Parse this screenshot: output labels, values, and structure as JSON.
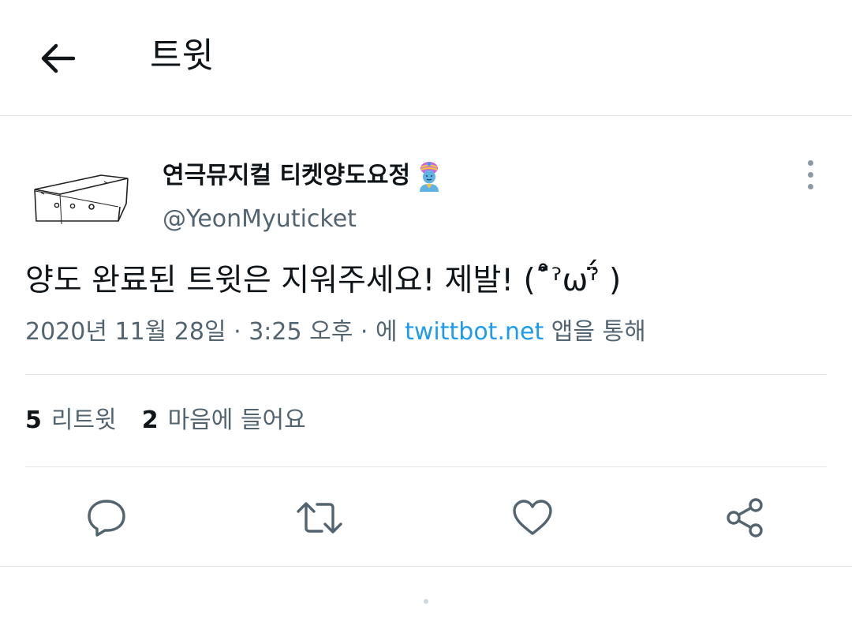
{
  "header": {
    "title": "트윗",
    "back_icon": "arrow-left-icon"
  },
  "author": {
    "display_name": "연극뮤지컬 티켓양도요정",
    "name_emoji": "genie-emoji-icon",
    "handle": "@YeonMyuticket",
    "avatar_icon": "sketch-box-avatar"
  },
  "tweet": {
    "text": "양도 완료된 트윗은 지워주세요! 제발! (˚̑̈́ˀωˀ̈́ )",
    "date": "2020년 11월 28일",
    "separator": "·",
    "time": "3:25 오후",
    "via_prefix": "에",
    "source": "twittbot.net",
    "via_suffix": "앱을 통해"
  },
  "stats": {
    "retweets_count": "5",
    "retweets_label": "리트윗",
    "likes_count": "2",
    "likes_label": "마음에 들어요"
  },
  "actions": [
    {
      "name": "reply",
      "icon": "reply-bubble-icon"
    },
    {
      "name": "retweet",
      "icon": "retweet-arrows-icon"
    },
    {
      "name": "like",
      "icon": "heart-icon"
    },
    {
      "name": "share",
      "icon": "share-icon"
    }
  ],
  "colors": {
    "text_primary": "#0f1419",
    "text_secondary": "#536471",
    "link": "#1d9bf0",
    "divider": "#dfe4e8",
    "icon": "#536471"
  }
}
